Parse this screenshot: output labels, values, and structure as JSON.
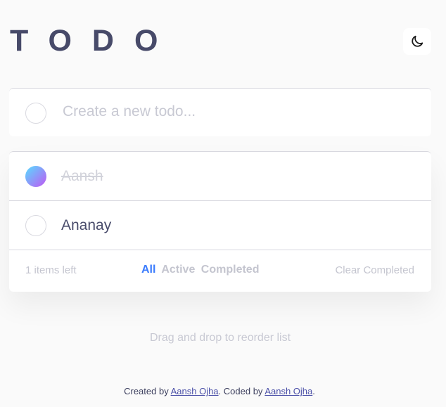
{
  "header": {
    "title": "TODO",
    "theme_icon": "moon-icon"
  },
  "new_todo": {
    "placeholder": "Create a new todo..."
  },
  "todos": [
    {
      "text": "Aansh",
      "completed": true
    },
    {
      "text": "Ananay",
      "completed": false
    }
  ],
  "footer": {
    "items_left": "1 items left",
    "filters": [
      "All",
      "Active",
      "Completed"
    ],
    "active_filter": "All",
    "clear_label": "Clear Completed"
  },
  "drag_hint": "Drag and drop to reorder list",
  "attribution": {
    "prefix": "Created by ",
    "author_1": "Aansh Ojha",
    "middle": ". Coded by ",
    "author_2": "Aansh Ojha",
    "suffix": "."
  },
  "colors": {
    "accent": "#3a7bfd",
    "check_gradient_start": "#57ddff",
    "check_gradient_end": "#c058f3",
    "background": "#fafafa"
  }
}
